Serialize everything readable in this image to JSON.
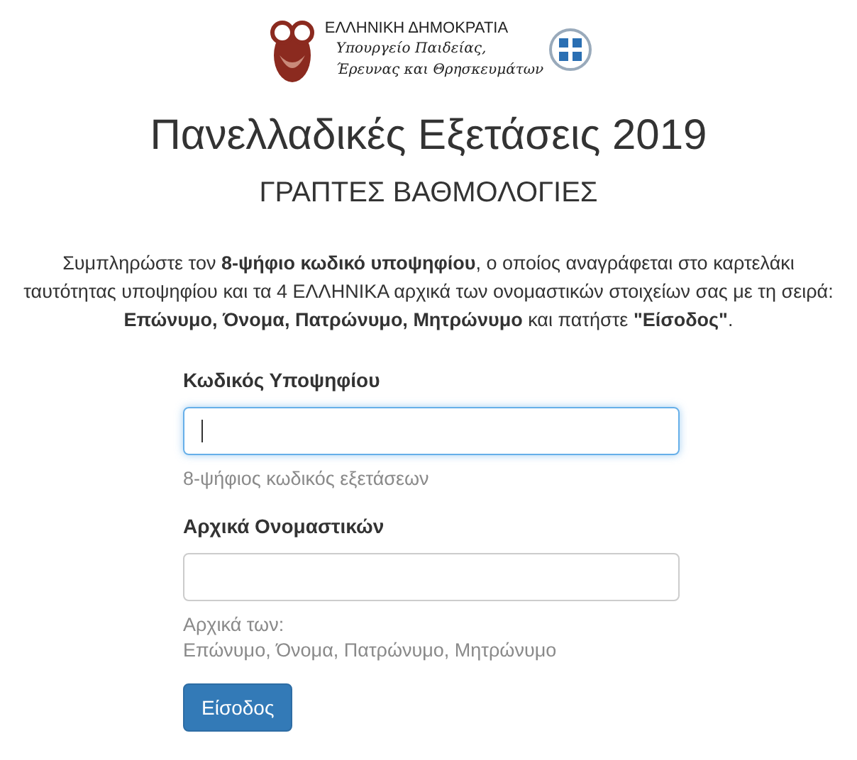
{
  "logo": {
    "title": "ΕΛΛΗΝΙΚΗ ΔΗΜΟΚΡΑΤΙΑ",
    "ministry_lines": [
      "Υπουργείο Παιδείας,",
      "Έρευνας και Θρησκευμάτων"
    ]
  },
  "heading": "Πανελλαδικές Εξετάσεις 2019",
  "subheading": "ΓΡΑΠΤΕΣ ΒΑΘΜΟΛΟΓΙΕΣ",
  "intro_lines": [
    "Συμπληρώστε τον **8-ψήφιο κωδικό υποψηφίου**, ο οποίος αναγράφεται στο καρτελάκι",
    "ταυτότητας υποψηφίου και τα 4 ΕΛΛΗΝΙΚΑ αρχικά των ονομαστικών στοιχείων σας με τη σειρά:",
    "**Επώνυμο, Όνομα, Πατρώνυμο, Μητρώνυμο** και πατήστε **\"Είσοδος\"**."
  ],
  "fields": [
    {
      "label": "Κωδικός Υποψηφίου",
      "focused": true,
      "help": [
        "8-ψήφιος κωδικός εξετάσεων"
      ]
    },
    {
      "label": "Αρχικά Ονομαστικών",
      "focused": false,
      "help": [
        "Αρχικά των:",
        "Επώνυμο, Όνομα, Πατρώνυμο, Μητρώνυμο"
      ]
    }
  ],
  "submit": "Είσοδος"
}
